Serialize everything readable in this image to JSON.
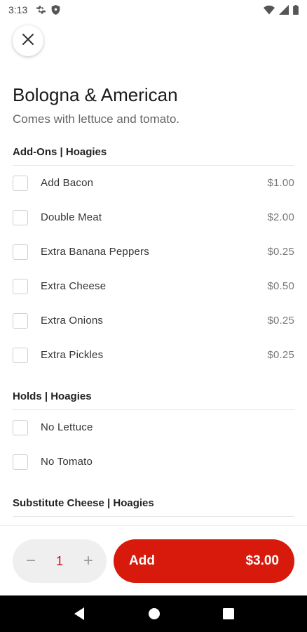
{
  "status_bar": {
    "time": "3:13",
    "left_icons": [
      "settings-icon",
      "shield-icon"
    ],
    "right_icons": [
      "wifi-icon",
      "signal-icon",
      "battery-icon"
    ]
  },
  "item": {
    "title": "Bologna & American",
    "description": "Comes with lettuce and tomato."
  },
  "sections": [
    {
      "header": "Add-Ons | Hoagies",
      "options": [
        {
          "label": "Add Bacon",
          "price": "$1.00"
        },
        {
          "label": "Double Meat",
          "price": "$2.00"
        },
        {
          "label": "Extra Banana Peppers",
          "price": "$0.25"
        },
        {
          "label": "Extra Cheese",
          "price": "$0.50"
        },
        {
          "label": "Extra Onions",
          "price": "$0.25"
        },
        {
          "label": "Extra Pickles",
          "price": "$0.25"
        }
      ]
    },
    {
      "header": "Holds | Hoagies",
      "options": [
        {
          "label": "No Lettuce",
          "price": ""
        },
        {
          "label": "No Tomato",
          "price": ""
        }
      ]
    },
    {
      "header": "Substitute Cheese | Hoagies",
      "options": []
    }
  ],
  "footer": {
    "quantity": "1",
    "decrement_symbol": "−",
    "increment_symbol": "+",
    "add_label": "Add",
    "add_price": "$3.00"
  },
  "colors": {
    "accent": "#d71a0c",
    "quantity_text": "#d0021b"
  },
  "nav_bar": {
    "icons": [
      "back-icon",
      "home-icon",
      "recents-icon"
    ]
  }
}
